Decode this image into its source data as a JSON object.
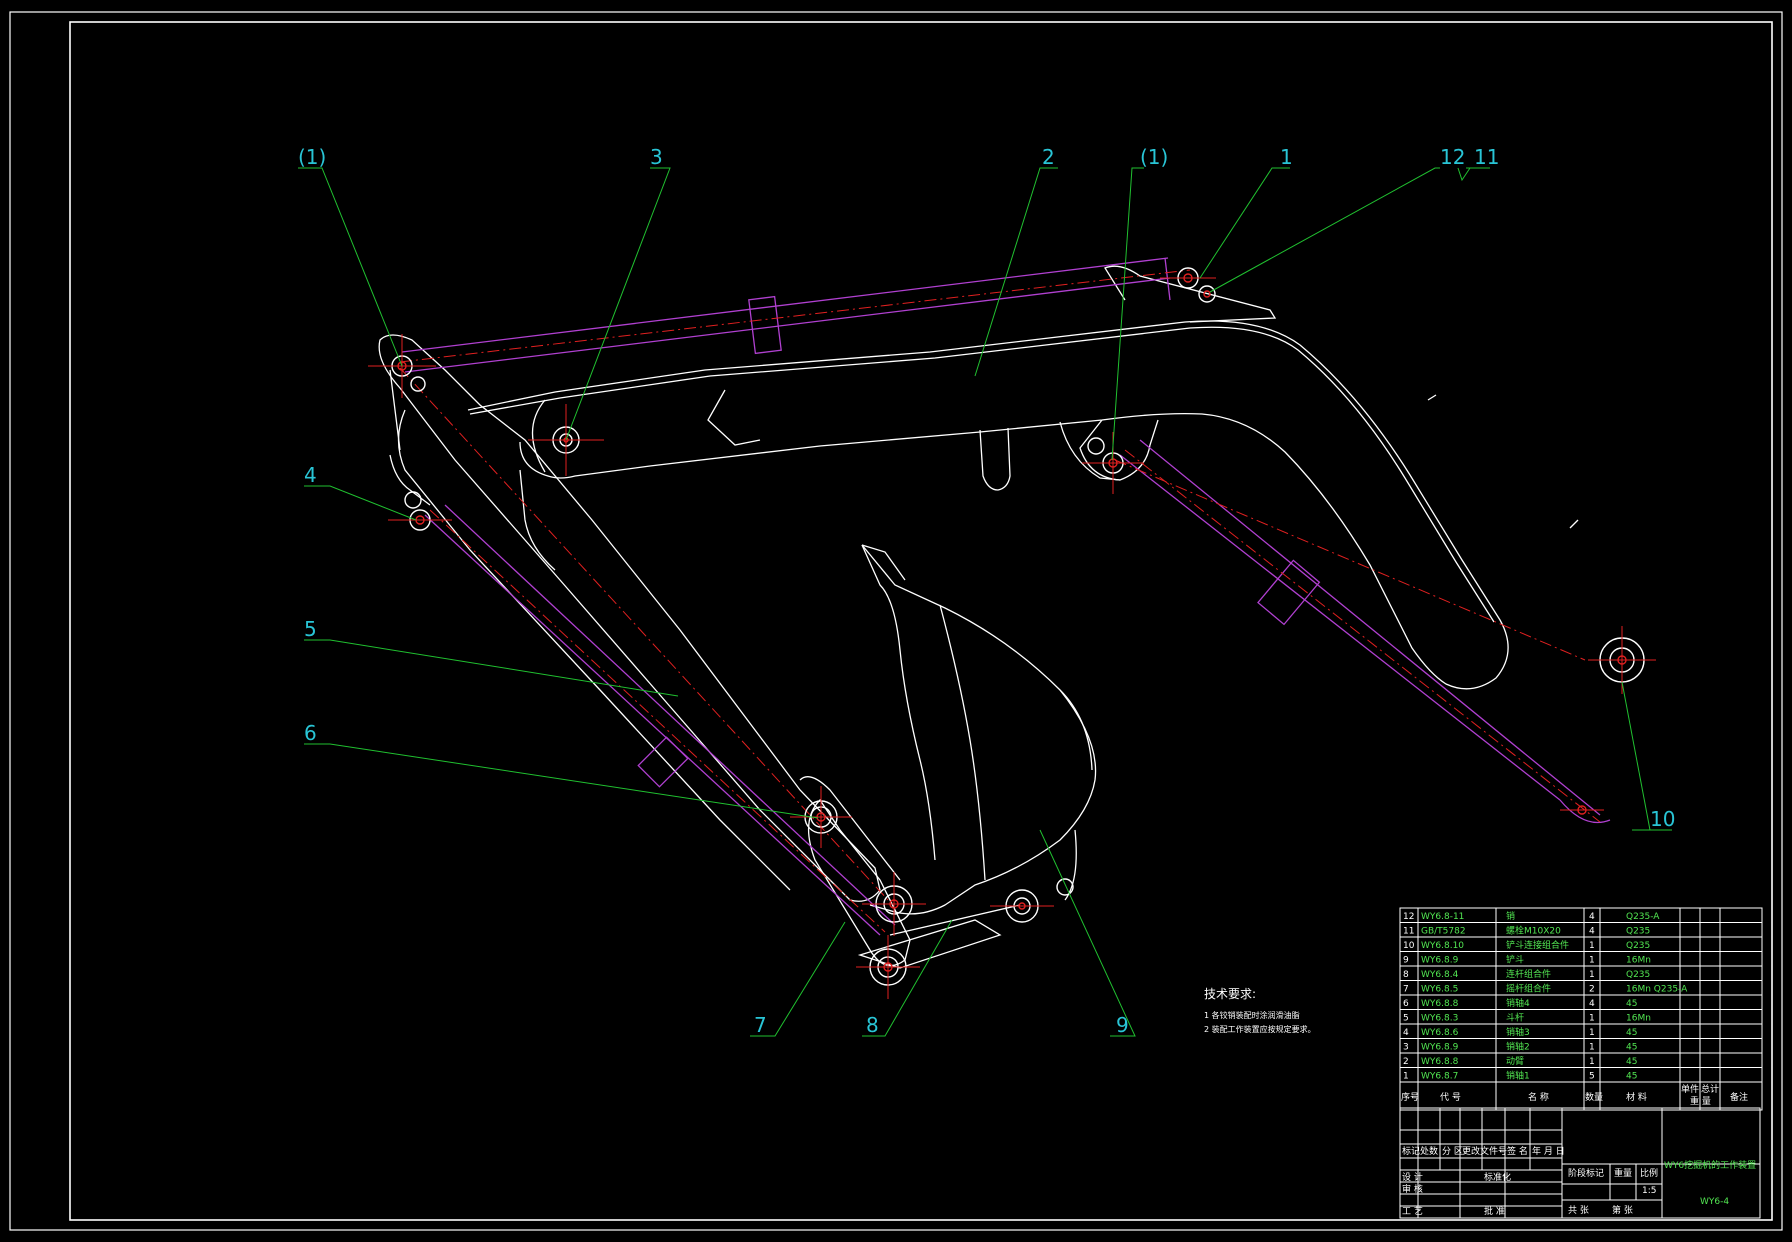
{
  "colors": {
    "background": "#000000",
    "outline": "#ffffff",
    "cylinder": "#b040d0",
    "centerline": "#e02020",
    "leader": "#20c030",
    "label": "#29c5d6",
    "title_text": "#52e652"
  },
  "part_labels": [
    {
      "id": "p1a",
      "text": "(1)"
    },
    {
      "id": "p3",
      "text": "3"
    },
    {
      "id": "p2",
      "text": "2"
    },
    {
      "id": "p1b",
      "text": "(1)"
    },
    {
      "id": "p1",
      "text": "1"
    },
    {
      "id": "p12",
      "text": "12"
    },
    {
      "id": "p11",
      "text": "11"
    },
    {
      "id": "p4",
      "text": "4"
    },
    {
      "id": "p5",
      "text": "5"
    },
    {
      "id": "p6",
      "text": "6"
    },
    {
      "id": "p10",
      "text": "10"
    },
    {
      "id": "p7",
      "text": "7"
    },
    {
      "id": "p8",
      "text": "8"
    },
    {
      "id": "p9",
      "text": "9"
    }
  ],
  "tech_requirements": {
    "heading": "技术要求:",
    "items": [
      "1 各铰销装配时涂润滑油脂",
      "2 装配工作装置应按规定要求。"
    ]
  },
  "bom": {
    "rows": [
      {
        "no": "12",
        "code": "WY6.8-11",
        "name": "销",
        "qty": "4",
        "material": "Q235-A"
      },
      {
        "no": "11",
        "code": "GB/T5782",
        "name": "螺栓M10X20",
        "qty": "4",
        "material": "Q235"
      },
      {
        "no": "10",
        "code": "WY6.8.10",
        "name": "铲斗连接组合件",
        "qty": "1",
        "material": "Q235"
      },
      {
        "no": "9",
        "code": "WY6.8.9",
        "name": "铲斗",
        "qty": "1",
        "material": "16Mn"
      },
      {
        "no": "8",
        "code": "WY6.8.4",
        "name": "连杆组合件",
        "qty": "1",
        "material": "Q235"
      },
      {
        "no": "7",
        "code": "WY6.8.5",
        "name": "摇杆组合件",
        "qty": "2",
        "material": "16Mn Q235-A"
      },
      {
        "no": "6",
        "code": "WY6.8.8",
        "name": "销轴4",
        "qty": "4",
        "material": "45"
      },
      {
        "no": "5",
        "code": "WY6.8.3",
        "name": "斗杆",
        "qty": "1",
        "material": "16Mn"
      },
      {
        "no": "4",
        "code": "WY6.8.6",
        "name": "销轴3",
        "qty": "1",
        "material": "45"
      },
      {
        "no": "3",
        "code": "WY6.8.9",
        "name": "销轴2",
        "qty": "1",
        "material": "45"
      },
      {
        "no": "2",
        "code": "WY6.8.8",
        "name": "动臂",
        "qty": "1",
        "material": "45"
      },
      {
        "no": "1",
        "code": "WY6.8.7",
        "name": "销轴1",
        "qty": "5",
        "material": "45"
      }
    ],
    "header": {
      "no": "序号",
      "code": "代 号",
      "name": "名 称",
      "qty": "数量",
      "material": "材 料",
      "single": "单件",
      "total": "总计",
      "weight": "重 量",
      "remark": "备注"
    }
  },
  "title_block": {
    "title": "WY6挖掘机的工作装置",
    "drawing_no": "WY6-4",
    "scale_label": "比例",
    "scale": "1:5",
    "stage_label": "阶段标记",
    "weight_label": "重量",
    "sheet_total": "共 张",
    "sheet_no": "第 张",
    "rev_labels": [
      "标记",
      "处数",
      "分 区",
      "更改文件号",
      "签 名",
      "年 月 日"
    ],
    "role_labels": [
      "设 计",
      "审 核",
      "工 艺"
    ],
    "std_label": "标准化",
    "approve_label": "批 准"
  }
}
